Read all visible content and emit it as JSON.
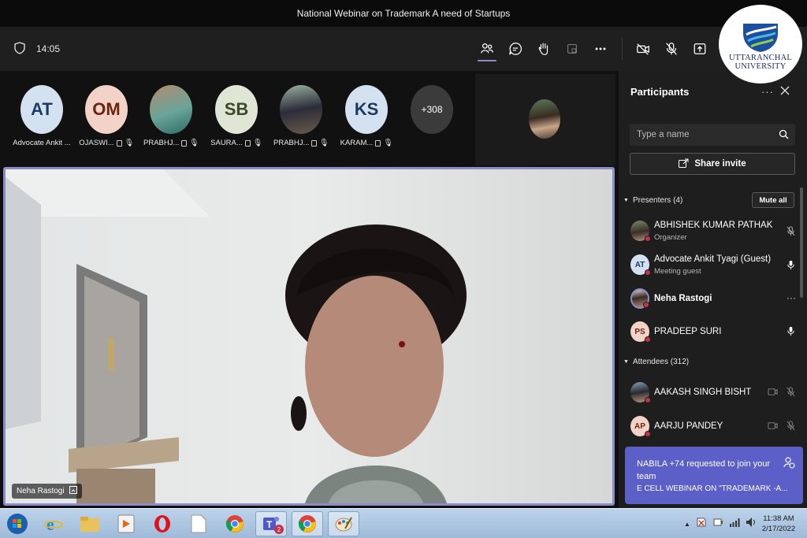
{
  "window": {
    "title": "National Webinar on Trademark A need of Startups"
  },
  "toolbar": {
    "time": "14:05"
  },
  "logo": {
    "line1": "UTTARANCHAL",
    "line2": "UNIVERSITY"
  },
  "strip": {
    "tiles": [
      {
        "initials": "AT",
        "label": "Advocate Ankit ...",
        "bg": "#d3e1f0",
        "fg": "#1f3a5f"
      },
      {
        "initials": "OM",
        "label": "OJASWI...",
        "bg": "#f3d3c8",
        "fg": "#6a2412"
      },
      {
        "initials": "",
        "label": "PRABHJ...",
        "bg": "#9aa88a",
        "fg": "#fff"
      },
      {
        "initials": "SB",
        "label": "SAURA...",
        "bg": "#dfe6d5",
        "fg": "#3a4a2a"
      },
      {
        "initials": "",
        "label": "PRABHJ...",
        "bg": "#6e7e6a",
        "fg": "#fff"
      },
      {
        "initials": "KS",
        "label": "KARAM...",
        "bg": "#d3e1f0",
        "fg": "#1f3a5f"
      }
    ],
    "more": "+308"
  },
  "video": {
    "speaker": "Neha Rastogi"
  },
  "panel": {
    "title": "Participants",
    "search_placeholder": "Type a name",
    "share_label": "Share invite",
    "presenters_label": "Presenters (4)",
    "mute_all": "Mute all",
    "attendees_label": "Attendees (312)",
    "presenters": [
      {
        "name": "ABHISHEK KUMAR PATHAK",
        "sub": "Organizer",
        "initials": "",
        "color": "#8a7a6a",
        "status": "#c4314b"
      },
      {
        "name": "Advocate Ankit Tyagi (Guest)",
        "sub": "Meeting guest",
        "initials": "AT",
        "color": "#d3e1f0",
        "status": "#c4314b"
      },
      {
        "name": "Neha Rastogi",
        "sub": "",
        "initials": "",
        "color": "#a08070",
        "status": "#c4314b"
      },
      {
        "name": "PRADEEP SURI",
        "sub": "",
        "initials": "PS",
        "color": "#f3d3c8",
        "status": "#c4314b"
      }
    ],
    "attendees": [
      {
        "name": "AAKASH SINGH BISHT",
        "initials": "",
        "color": "#7a8aa0",
        "status": "#c4314b"
      },
      {
        "name": "AARJU PANDEY",
        "initials": "AP",
        "color": "#f3d3c8",
        "status": "#c4314b"
      }
    ]
  },
  "toast": {
    "message": "NABILA +74 requested to join your team",
    "detail": "E CELL WEBINAR ON \"TRADEMARK -A..."
  },
  "taskbar": {
    "time": "11:38 AM",
    "date": "2/17/2022",
    "teams_badge": "2"
  }
}
